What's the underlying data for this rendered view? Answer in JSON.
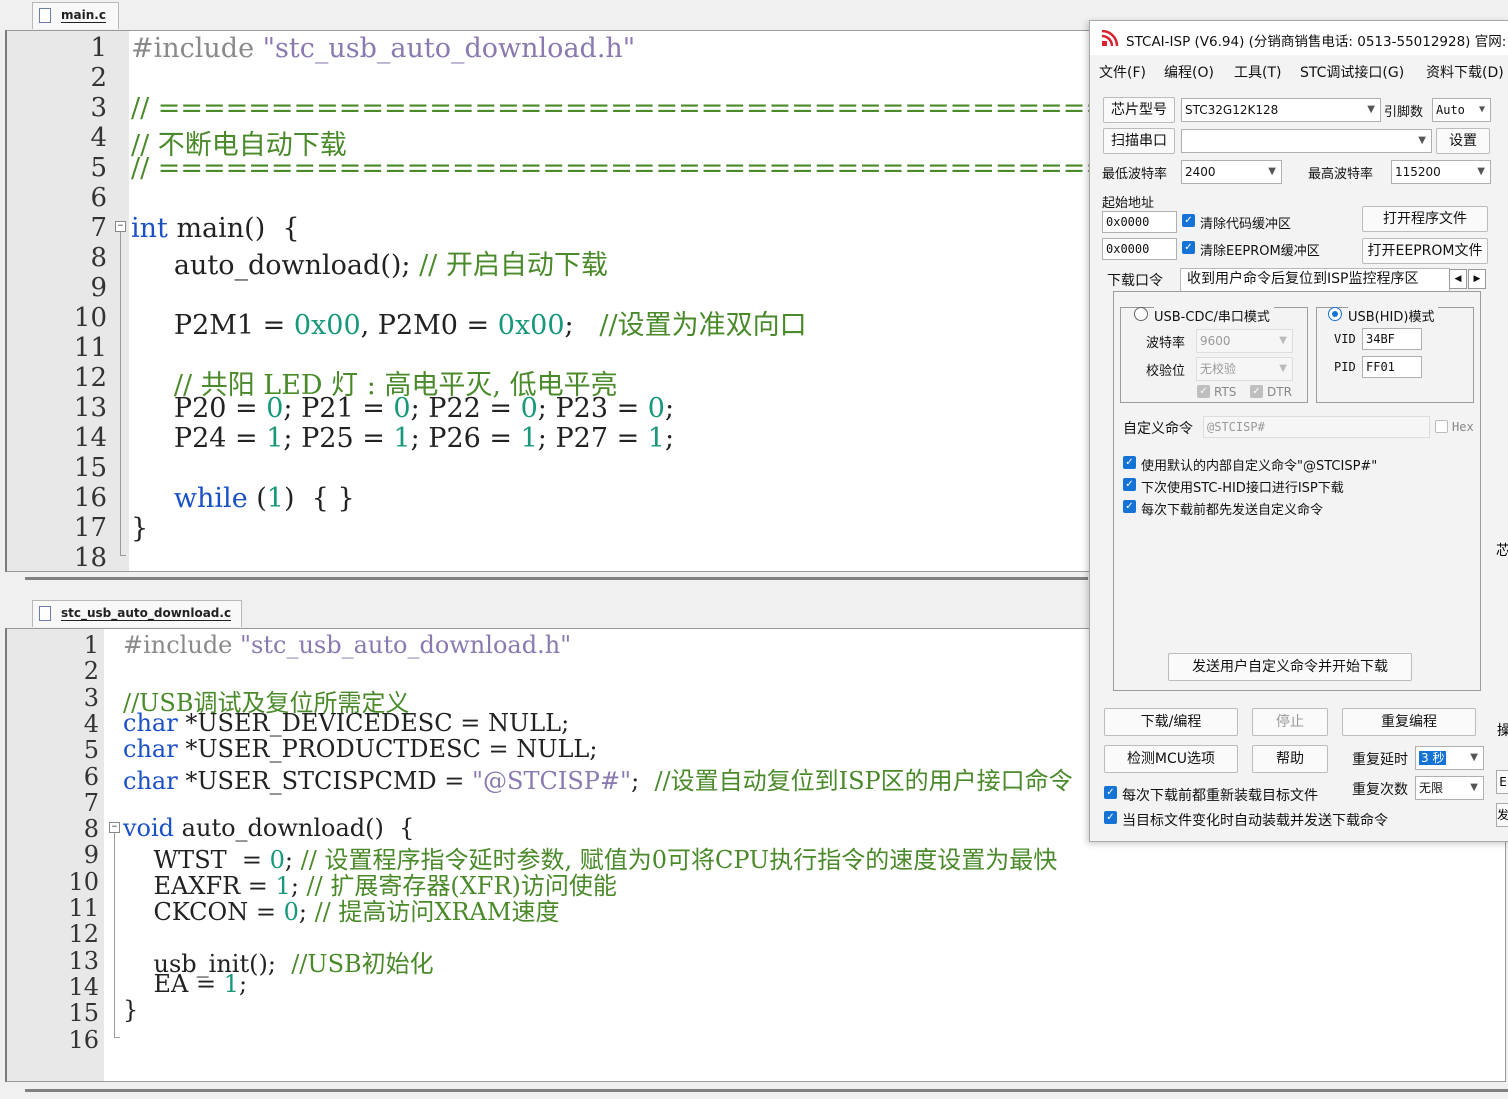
{
  "top_editor": {
    "tab_label": "main.c",
    "line_numbers": [
      "1",
      "2",
      "3",
      "4",
      "5",
      "6",
      "7",
      "8",
      "9",
      "10",
      "11",
      "12",
      "13",
      "14",
      "15",
      "16",
      "17",
      "18"
    ],
    "lines": {
      "l1_pp": "#include ",
      "l1_str": "\"stc_usb_auto_download.h\"",
      "l3": "// ===================================================================================",
      "l4": "// 不断电自动下载",
      "l5": "// ===================================================================================",
      "l7_kw": "int",
      "l7_rest": " main()  {",
      "l8_code": "     auto_download(); ",
      "l8_cm": "// 开启自动下载",
      "l10_a": "     P2M1 = ",
      "l10_n1": "0x00",
      "l10_b": ", P2M0 = ",
      "l10_n2": "0x00",
      "l10_c": ";   ",
      "l10_cm": "//设置为准双向口",
      "l12_cm": "     // 共阳 LED 灯 : 高电平灭, 低电平亮",
      "l13_a": "     P20 = ",
      "l13_b": "; P21 = ",
      "l13_c": "; P22 = ",
      "l13_d": "; P23 = ",
      "l13_e": ";",
      "l13_v": "0",
      "l14_a": "     P24 = ",
      "l14_b": "; P25 = ",
      "l14_c": "; P26 = ",
      "l14_d": "; P27 = ",
      "l14_e": ";",
      "l14_v": "1",
      "l16_kw": "while",
      "l16_a": " (",
      "l16_n": "1",
      "l16_b": ")  { }",
      "l17": "}"
    }
  },
  "bottom_editor": {
    "tab_label": "stc_usb_auto_download.c",
    "line_numbers": [
      "1",
      "2",
      "3",
      "4",
      "5",
      "6",
      "7",
      "8",
      "9",
      "10",
      "11",
      "12",
      "13",
      "14",
      "15",
      "16"
    ],
    "lines": {
      "l1_pp": "#include ",
      "l1_str": "\"stc_usb_auto_download.h\"",
      "l3": "//USB调试及复位所需定义",
      "l4_kw": "char",
      "l4_rest": " *USER_DEVICEDESC = NULL;",
      "l5_kw": "char",
      "l5_rest": " *USER_PRODUCTDESC = NULL;",
      "l6_kw": "char",
      "l6_a": " *USER_STCISPCMD = ",
      "l6_str": "\"@STCISP#\"",
      "l6_b": ";  ",
      "l6_cm": "//设置自动复位到ISP区的用户接口命令",
      "l8_kw": "void",
      "l8_rest": " auto_download()  {",
      "l9_a": "    WTST  = ",
      "l9_n": "0",
      "l9_b": "; ",
      "l9_cm": "// 设置程序指令延时参数, 赋值为0可将CPU执行指令的速度设置为最快",
      "l10_a": "    EAXFR = ",
      "l10_n": "1",
      "l10_b": "; ",
      "l10_cm": "// 扩展寄存器(XFR)访问使能",
      "l11_a": "    CKCON = ",
      "l11_n": "0",
      "l11_b": "; ",
      "l11_cm": "// 提高访问XRAM速度",
      "l13_a": "    usb_init();  ",
      "l13_cm": "//USB初始化",
      "l14_a": "    EA = ",
      "l14_n": "1",
      "l14_b": ";",
      "l15": "}"
    }
  },
  "isp": {
    "title": "STCAI-ISP (V6.94) (分销商销售电话: 0513-55012928) 官网:",
    "menu": [
      "文件(F)",
      "编程(O)",
      "工具(T)",
      "STC调试接口(G)",
      "资料下载(D)"
    ],
    "chip_label": "芯片型号",
    "chip_value": "STC32G12K128",
    "pins_label": "引脚数",
    "pins_value": "Auto",
    "scan_port_label": "扫描串口",
    "port_value": "",
    "settings_button": "设置",
    "min_baud_label": "最低波特率",
    "min_baud_value": "2400",
    "max_baud_label": "最高波特率",
    "max_baud_value": "115200",
    "start_addr_label": "起始地址",
    "addr1": "0x0000",
    "addr2": "0x0000",
    "clear_code_label": "清除代码缓冲区",
    "clear_eeprom_label": "清除EEPROM缓冲区",
    "open_program_button": "打开程序文件",
    "open_eeprom_button": "打开EEPROM文件",
    "tab_download": "下载口令",
    "tab_isp_monitor": "收到用户命令后复位到ISP监控程序区",
    "radio_cdc": "USB-CDC/串口模式",
    "radio_hid": "USB(HID)模式",
    "baud_label": "波特率",
    "baud_value": "9600",
    "parity_label": "校验位",
    "parity_value": "无校验",
    "rts_label": "RTS",
    "dtr_label": "DTR",
    "vid_label": "VID",
    "vid_value": "34BF",
    "pid_label": "PID",
    "pid_value": "FF01",
    "custom_cmd_label": "自定义命令",
    "custom_cmd_value": "@STCISP#",
    "hex_label": "Hex",
    "opt1": "使用默认的内部自定义命令\"@STCISP#\"",
    "opt2": "下次使用STC-HID接口进行ISP下载",
    "opt3": "每次下载前都先发送自定义命令",
    "send_cmd_button": "发送用户自定义命令并开始下载",
    "download_button": "下载/编程",
    "stop_button": "停止",
    "reprogram_button": "重复编程",
    "check_mcu_button": "检测MCU选项",
    "help_button": "帮助",
    "repeat_delay_label": "重复延时",
    "repeat_delay_value": "3 秒",
    "repeat_count_label": "重复次数",
    "repeat_count_value": "无限",
    "reload_label": "每次下载前都重新装载目标文件",
    "autoload_label": "当目标文件变化时自动装载并发送下载命令",
    "accent_color": "#1673d6"
  },
  "right_edge": {
    "c1": "芯",
    "c2": "操",
    "c3": "E",
    "c4": "发"
  }
}
